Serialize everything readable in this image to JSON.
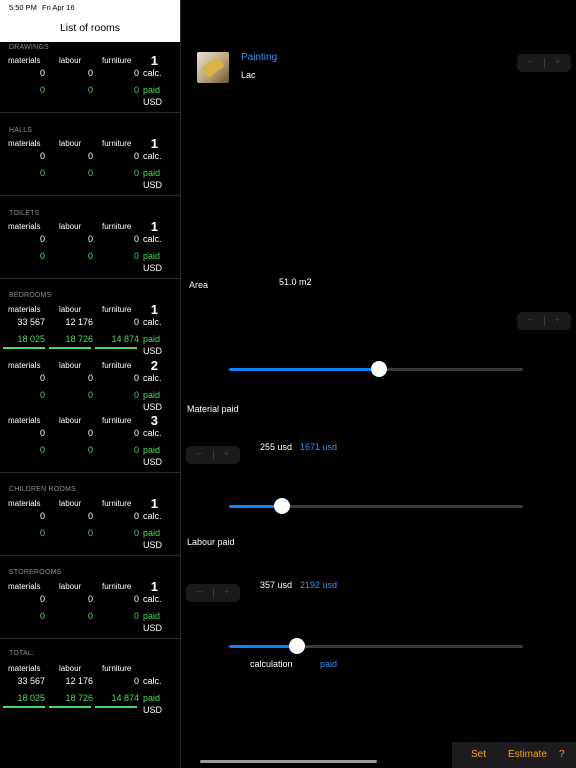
{
  "status": {
    "time": "5:50 PM",
    "date": "Fri Apr 16"
  },
  "sidebar": {
    "title": "List of rooms",
    "col_headers": {
      "materials": "materials",
      "labour": "labour",
      "furniture": "furniture"
    },
    "calc_label": "calc.",
    "paid_label": "paid",
    "currency": "USD",
    "sections": [
      {
        "title": "DRAWINGS",
        "rooms": [
          {
            "num": "1",
            "m": "0",
            "l": "0",
            "f": "0",
            "pm": "0",
            "pl": "0",
            "pf": "0"
          }
        ]
      },
      {
        "title": "HALLS",
        "rooms": [
          {
            "num": "1",
            "m": "0",
            "l": "0",
            "f": "0",
            "pm": "0",
            "pl": "0",
            "pf": "0"
          }
        ]
      },
      {
        "title": "TOILETS",
        "rooms": [
          {
            "num": "1",
            "m": "0",
            "l": "0",
            "f": "0",
            "pm": "0",
            "pl": "0",
            "pf": "0"
          }
        ]
      },
      {
        "title": "BEDROOMS",
        "rooms": [
          {
            "num": "1",
            "m": "33 567",
            "l": "12 176",
            "f": "0",
            "pm": "18 025",
            "pl": "18 726",
            "pf": "14 874"
          },
          {
            "num": "2",
            "m": "0",
            "l": "0",
            "f": "0",
            "pm": "0",
            "pl": "0",
            "pf": "0"
          },
          {
            "num": "3",
            "m": "0",
            "l": "0",
            "f": "0",
            "pm": "0",
            "pl": "0",
            "pf": "0"
          }
        ]
      },
      {
        "title": "CHILDREN ROOMS",
        "rooms": [
          {
            "num": "1",
            "m": "0",
            "l": "0",
            "f": "0",
            "pm": "0",
            "pl": "0",
            "pf": "0"
          }
        ]
      },
      {
        "title": "STOREROOMS",
        "rooms": [
          {
            "num": "1",
            "m": "0",
            "l": "0",
            "f": "0",
            "pm": "0",
            "pl": "0",
            "pf": "0"
          }
        ]
      }
    ],
    "total": {
      "title": "TOTAL:",
      "m": "33 567",
      "l": "12 176",
      "f": "0",
      "pm": "18 025",
      "pl": "18 726",
      "pf": "14 874"
    }
  },
  "detail": {
    "work_title": "Painting",
    "work_sub": "Lac",
    "area_label": "Area",
    "area_value": "51.0 m2",
    "material_label": "Material paid",
    "material_value": "255 usd",
    "material_total": "1671 usd",
    "labour_label": "Labour paid",
    "labour_value": "357 usd",
    "labour_total": "2192 usd",
    "calc_tab": "calculation",
    "paid_tab": "paid",
    "stepper_minus": "−",
    "stepper_plus": "+",
    "sliders": {
      "area": 0.51,
      "material": 0.18,
      "labour": 0.23
    }
  },
  "toolbar": {
    "set": "Set",
    "estimate": "Estimate",
    "help": "?"
  },
  "colors": {
    "accent": "#0a84ff",
    "paid": "#4cd964",
    "link": "#3a8ef6"
  }
}
